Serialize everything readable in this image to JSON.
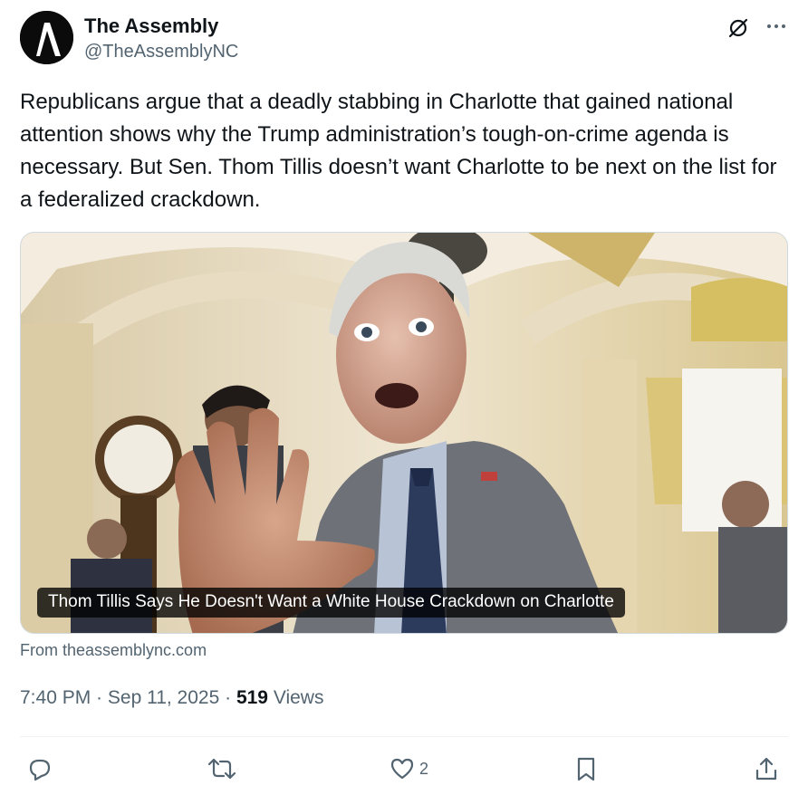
{
  "post": {
    "author_name": "The Assembly",
    "author_handle": "@TheAssemblyNC",
    "text": "Republicans argue that a deadly stabbing in Charlotte that gained national attention shows why the Trump administration’s tough-on-crime agenda is necessary. But Sen. Thom Tillis doesn’t want Charlotte to be next on the list for a federalized crackdown.",
    "card": {
      "title": "Thom Tillis Says He Doesn't Want a White House Crackdown on Charlotte",
      "source": "From theassemblync.com"
    },
    "time": "7:40 PM",
    "separator": " · ",
    "date": "Sep 11, 2025",
    "views_count": "519",
    "views_label": " Views"
  },
  "actions": {
    "reply_count": "",
    "repost_count": "",
    "like_count": "2"
  },
  "icons": {
    "avatar": "the-assembly-logo",
    "grok": "grok-icon",
    "more": "more-icon",
    "reply": "reply-icon",
    "repost": "repost-icon",
    "like": "heart-icon",
    "bookmark": "bookmark-icon",
    "share": "share-icon"
  },
  "colors": {
    "text": "#0f1419",
    "secondary": "#536471",
    "divider": "#eff3f4"
  }
}
